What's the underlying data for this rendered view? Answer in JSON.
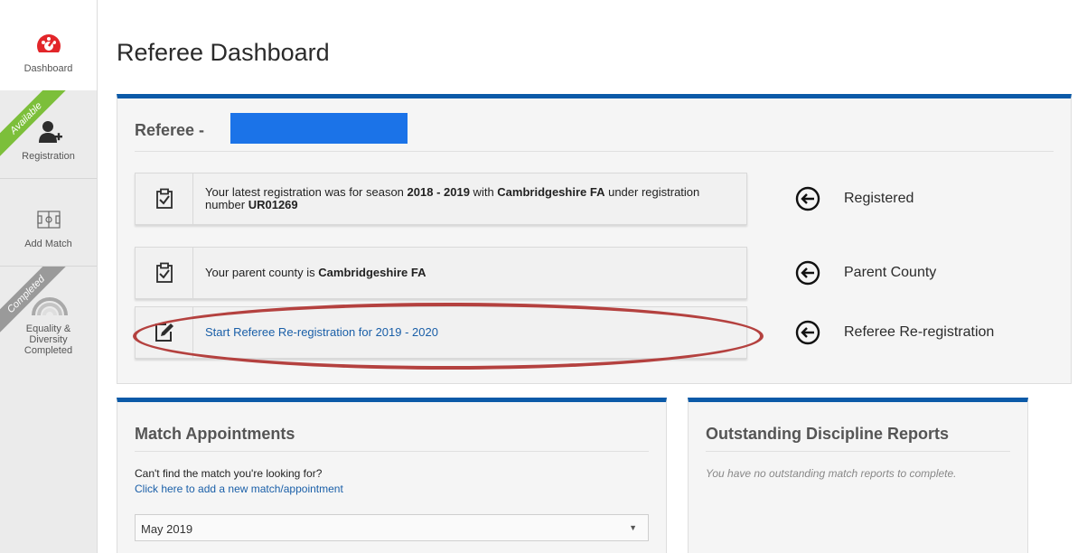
{
  "sidebar": {
    "dashboard": {
      "label": "Dashboard"
    },
    "registration": {
      "label": "Registration",
      "ribbon": "Available"
    },
    "add_match": {
      "label": "Add Match"
    },
    "equality": {
      "label_line1": "Equality &",
      "label_line2": "Diversity",
      "label_line3": "Completed",
      "ribbon": "Completed"
    }
  },
  "page": {
    "title": "Referee Dashboard"
  },
  "referee": {
    "heading": "Referee -",
    "cards": [
      {
        "text_1": "Your latest registration was for season ",
        "season": "2018 - 2019",
        "text_2": " with ",
        "county": "Cambridgeshire FA",
        "text_3": " under registration number ",
        "reg_number": "UR01269",
        "status": "Registered"
      },
      {
        "text_1": "Your parent county is ",
        "county": "Cambridgeshire FA",
        "status": "Parent County"
      },
      {
        "link": "Start Referee Re-registration for 2019 - 2020",
        "status": "Referee Re-registration"
      }
    ]
  },
  "match_appointments": {
    "heading": "Match Appointments",
    "prompt": "Can't find the match you're looking for?",
    "link": "Click here to add a new match/appointment",
    "month_selected": "May 2019"
  },
  "discipline": {
    "heading": "Outstanding Discipline Reports",
    "empty_text": "You have no outstanding match reports to complete."
  },
  "colors": {
    "accent": "#0b5aa8",
    "dashboard_icon": "#e2262a",
    "available": "#7cbf3a",
    "highlight": "#b4413f",
    "redaction": "#1b73e8"
  }
}
